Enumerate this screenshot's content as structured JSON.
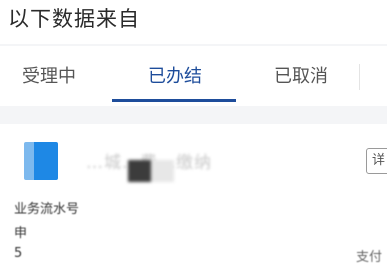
{
  "header": {
    "title": "以下数据来自"
  },
  "tabs": [
    {
      "label": "受理中",
      "active": false
    },
    {
      "label": "已办结",
      "active": true
    },
    {
      "label": "已取消",
      "active": false
    }
  ],
  "card": {
    "item_name": "…城…费…缴纳",
    "detail_label": "详",
    "rows": {
      "serial_label": "业务流水号",
      "row2": "申",
      "row3": "5",
      "row3_right": "支付"
    }
  },
  "colors": {
    "accent": "#1e4d9b",
    "icon_blue": "#1e88e5"
  }
}
